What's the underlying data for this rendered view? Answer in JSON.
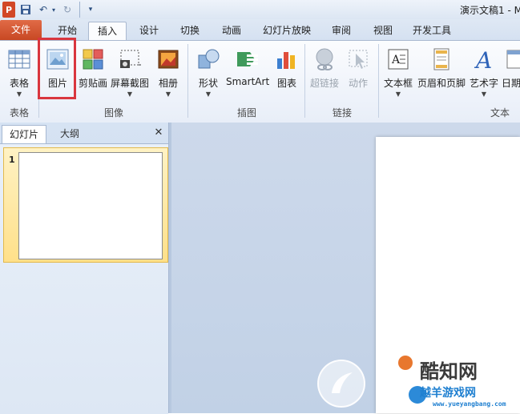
{
  "window": {
    "title": "演示文稿1 - M"
  },
  "tabs": {
    "file": "文件",
    "items": [
      "开始",
      "插入",
      "设计",
      "切换",
      "动画",
      "幻灯片放映",
      "审阅",
      "视图",
      "开发工具"
    ],
    "active": "插入"
  },
  "ribbon": {
    "groups": {
      "table": "表格",
      "image": "图像",
      "illustrations": "插图",
      "links": "链接",
      "text": "文本"
    },
    "buttons": {
      "table": "表格",
      "picture": "图片",
      "clipart": "剪贴画",
      "screenshot": "屏幕截图",
      "album": "相册",
      "shapes": "形状",
      "smartart": "SmartArt",
      "chart": "图表",
      "hyperlink": "超链接",
      "action": "动作",
      "textbox": "文本框",
      "header_footer": "页眉和页脚",
      "wordart": "艺术字",
      "datetime": "日期"
    }
  },
  "panel": {
    "tab_slides": "幻灯片",
    "tab_outline": "大纲",
    "close_glyph": "✕",
    "slide_number": "1"
  },
  "watermark": {
    "brand": "酷知网",
    "sub": "越羊游戏网",
    "url": "www.yueyangbang.com"
  },
  "colors": {
    "file_tab": "#d24726",
    "highlight": "#d9363e",
    "ribbon_bg": "#f4f7fc",
    "panel_bg": "#d6e3f3"
  }
}
